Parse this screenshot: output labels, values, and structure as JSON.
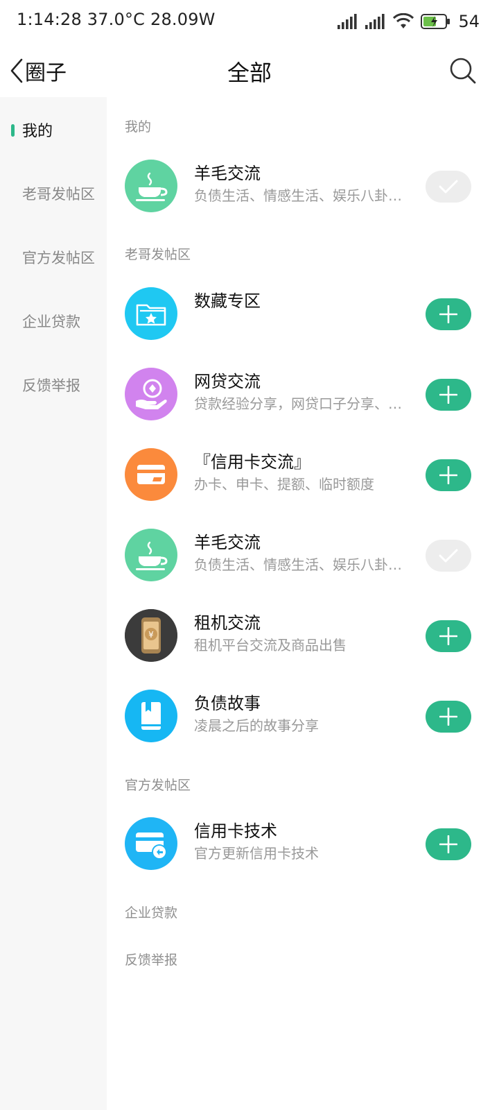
{
  "status_bar": {
    "left_text": "1:14:28 37.0°C  28.09W",
    "battery_percent": "54",
    "icons": [
      "signal-icon",
      "signal-icon",
      "wifi-icon",
      "battery-charging-icon"
    ]
  },
  "header": {
    "back_label": "圈子",
    "title": "全部",
    "icons": [
      "back-chevron-icon",
      "search-icon"
    ]
  },
  "sidebar": {
    "items": [
      {
        "label": "我的",
        "active": true
      },
      {
        "label": "老哥发帖区",
        "active": false
      },
      {
        "label": "官方发帖区",
        "active": false
      },
      {
        "label": "企业贷款",
        "active": false
      },
      {
        "label": "反馈举报",
        "active": false
      }
    ],
    "indicator_color": "#2db88a"
  },
  "sections": [
    {
      "title": "我的",
      "items": [
        {
          "title": "羊毛交流",
          "desc": "负债生活、情感生活、娱乐八卦、吃喝玩乐",
          "icon": "coffee-cup-icon",
          "color": "#5fd3a1",
          "joined": true
        }
      ]
    },
    {
      "title": "老哥发帖区",
      "items": [
        {
          "title": "数藏专区",
          "desc": "",
          "icon": "star-folder-icon",
          "color": "#1fc8f2",
          "joined": false
        },
        {
          "title": "网贷交流",
          "desc": "贷款经验分享，网贷口子分享、网贷资讯",
          "icon": "hand-coin-icon",
          "color": "#d183ee",
          "joined": false
        },
        {
          "title": "『信用卡交流』",
          "desc": "办卡、申卡、提额、临时额度",
          "icon": "credit-card-icon",
          "color": "#fb8a3c",
          "joined": false
        },
        {
          "title": "羊毛交流",
          "desc": "负债生活、情感生活、娱乐八卦、吃喝玩乐",
          "icon": "coffee-cup-icon",
          "color": "#5fd3a1",
          "joined": true
        },
        {
          "title": "租机交流",
          "desc": "租机平台交流及商品出售",
          "icon": "phone-yuan-icon",
          "color": "#3b3b3b",
          "joined": false
        },
        {
          "title": "负债故事",
          "desc": "凌晨之后的故事分享",
          "icon": "book-icon",
          "color": "#16b7f3",
          "joined": false
        }
      ]
    },
    {
      "title": "官方发帖区",
      "items": [
        {
          "title": "信用卡技术",
          "desc": "官方更新信用卡技术",
          "icon": "card-refresh-icon",
          "color": "#1fb5f5",
          "joined": false
        }
      ]
    },
    {
      "title": "企业贷款",
      "items": []
    },
    {
      "title": "反馈举报",
      "items": []
    }
  ],
  "colors": {
    "accent": "#2db88a",
    "joined_bg": "#ededed"
  }
}
